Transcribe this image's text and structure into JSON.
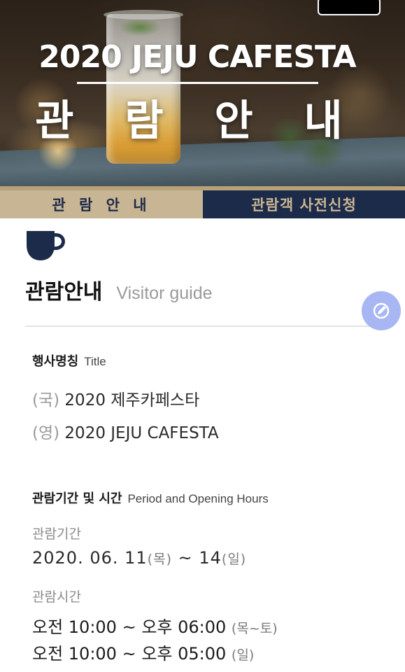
{
  "hero": {
    "event_title": "2020 JEJU CAFESTA",
    "page_title": "관 람 안 내"
  },
  "tabs": [
    {
      "label": "관 람 안 내",
      "active": true
    },
    {
      "label": "관람객 사전신청",
      "active": false
    }
  ],
  "section": {
    "icon": "coffee-cup-icon",
    "title_ko": "관람안내",
    "title_en": "Visitor guide"
  },
  "fab": {
    "icon": "pencil-icon"
  },
  "event_name": {
    "label_ko": "행사명칭",
    "label_en": "Title",
    "lines": [
      {
        "prefix": "(국)",
        "text": "2020 제주카페스타"
      },
      {
        "prefix": "(영)",
        "text": "2020 JEJU CAFESTA"
      }
    ]
  },
  "period": {
    "label_ko": "관람기간 및 시간",
    "label_en": "Period and Opening Hours",
    "dates_label": "관람기간",
    "dates_start": "2020. 06. 11",
    "dates_start_day": "(목)",
    "dates_sep": " ~ ",
    "dates_end": "14",
    "dates_end_day": "(일)",
    "hours_label": "관람시간",
    "hours": [
      {
        "text": "오전 10:00 ~ 오후 06:00",
        "days": "(목~토)"
      },
      {
        "text": "오전 10:00 ~ 오후 05:00",
        "days": "(일)"
      }
    ]
  },
  "colors": {
    "navy": "#1d2b4a",
    "gold": "#c8b593",
    "fab": "#a8b6f3"
  }
}
